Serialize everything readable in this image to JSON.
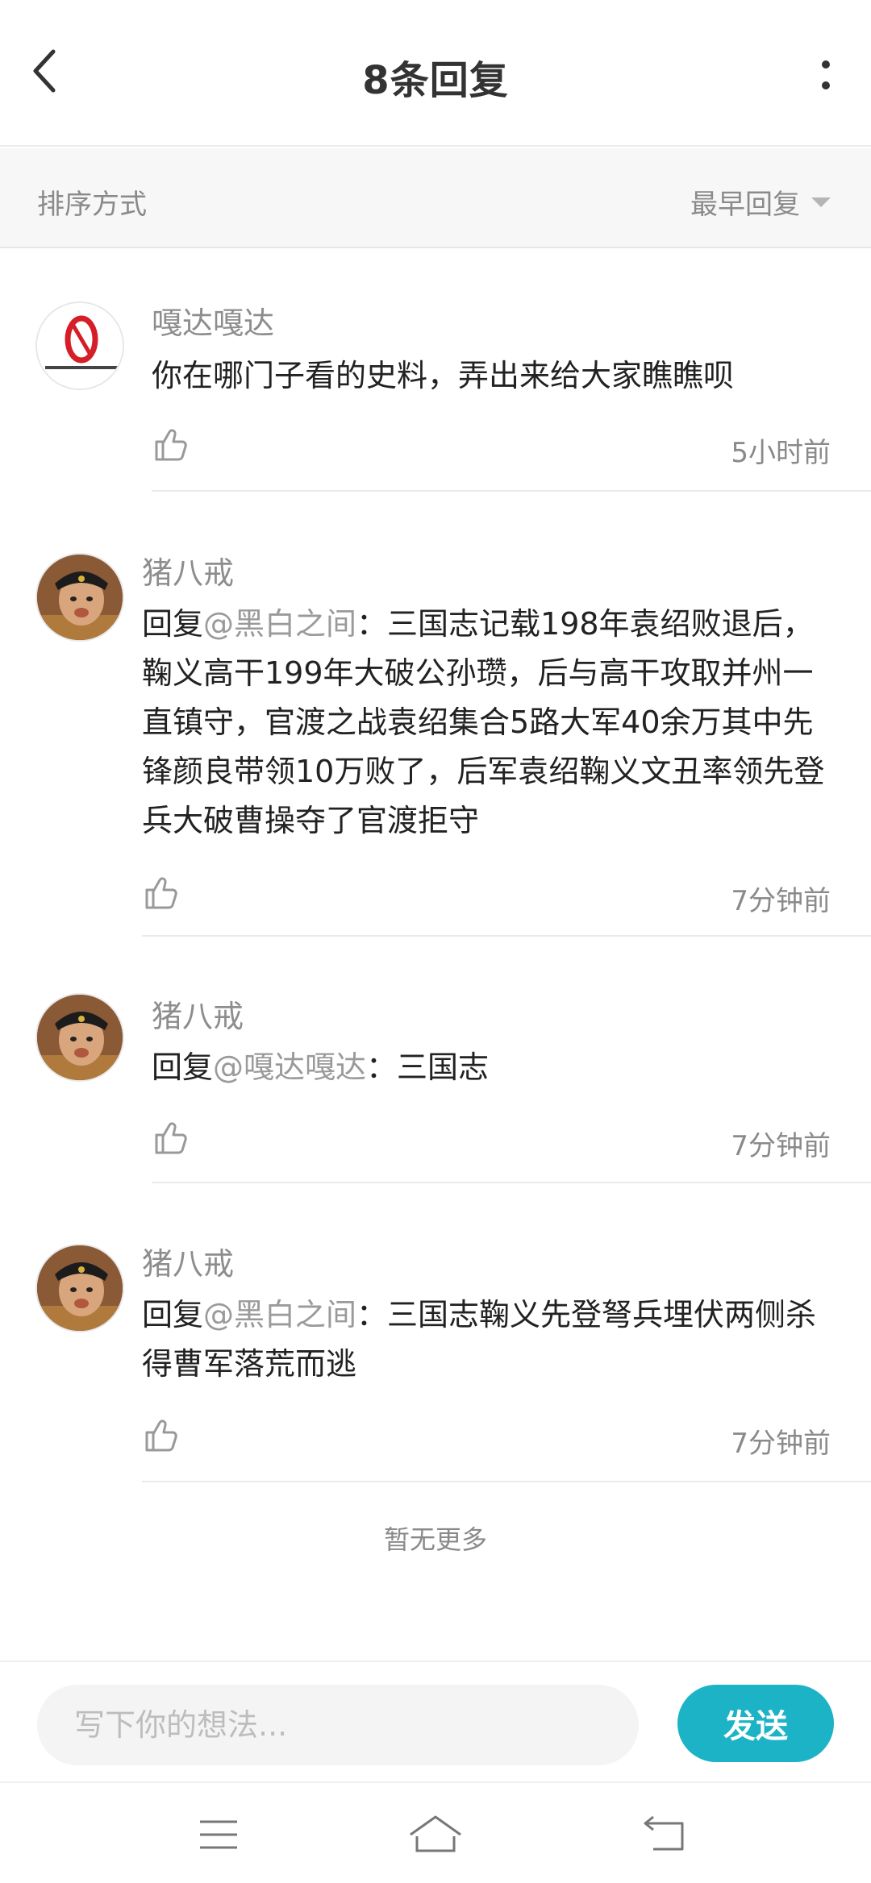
{
  "header": {
    "title": "8条回复",
    "back_icon": "chevron-left-icon",
    "more_icon": "vertical-dots-icon"
  },
  "sort": {
    "label": "排序方式",
    "selected": "最早回复"
  },
  "comments": [
    {
      "author": "嘎达嘎达",
      "text": "你在哪门子看的史料，弄出来给大家瞧瞧呗",
      "time": "5小时前"
    },
    {
      "author": "猪八戒",
      "reply_prefix": "回复",
      "mention": "@黑白之间",
      "text": "：三国志记载198年袁绍败退后，鞠义高干199年大破公孙瓒，后与高干攻取并州一直镇守，官渡之战袁绍集合5路大军40余万其中先锋颜良带领10万败了，后军袁绍鞠义文丑率领先登兵大破曹操夺了官渡拒守",
      "time": "7分钟前"
    },
    {
      "author": "猪八戒",
      "reply_prefix": "回复",
      "mention": "@嘎达嘎达",
      "text": "：三国志",
      "time": "7分钟前"
    },
    {
      "author": "猪八戒",
      "reply_prefix": "回复",
      "mention": "@黑白之间",
      "text": "：三国志鞠义先登弩兵埋伏两侧杀得曹军落荒而逃",
      "time": "7分钟前"
    }
  ],
  "footer_note": "暂无更多",
  "composer": {
    "placeholder": "写下你的想法...",
    "send_label": "发送"
  },
  "colors": {
    "accent": "#1cb3c6",
    "muted": "#8a8a8a"
  }
}
